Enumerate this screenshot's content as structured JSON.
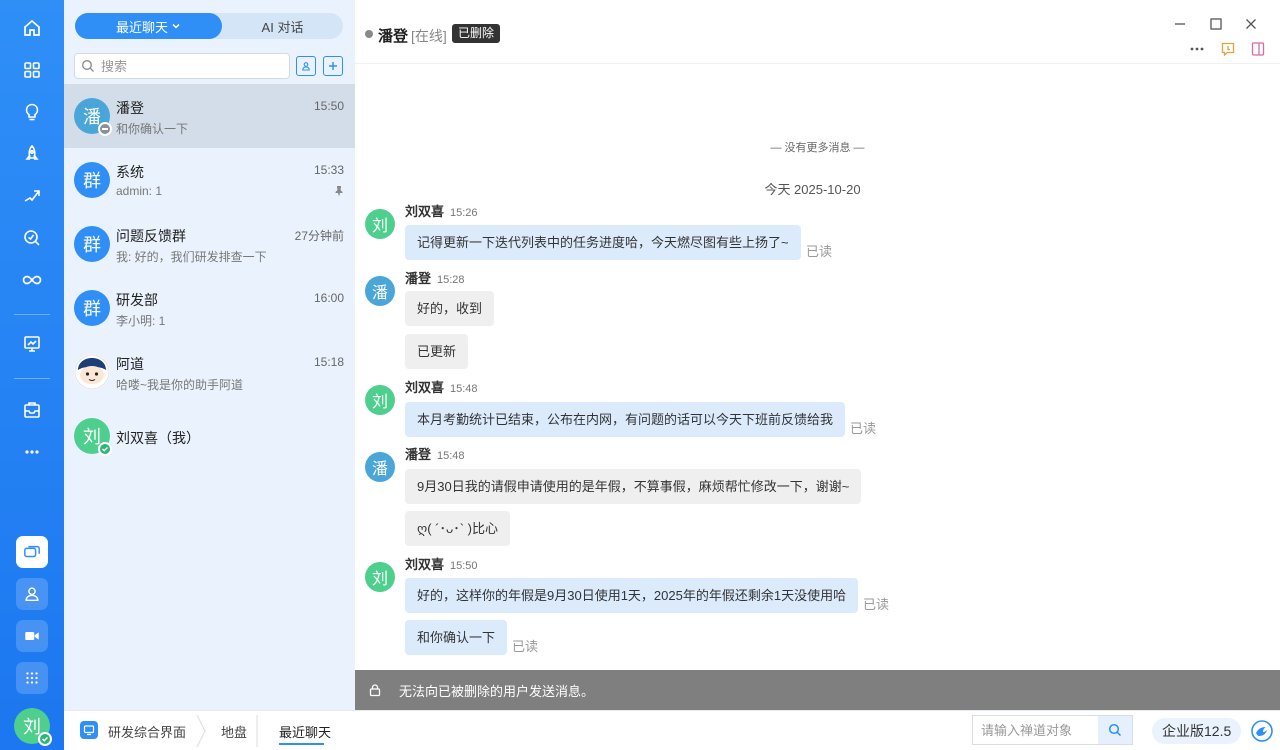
{
  "sidebar": {
    "tabs": {
      "recent": "最近聊天",
      "ai": "AI 对话"
    },
    "search_placeholder": "搜索",
    "conversations": [
      {
        "name": "潘登",
        "time": "15:50",
        "preview": "和你确认一下",
        "avatar": "潘",
        "avatar_color": "#4aa6d8",
        "status": "offline",
        "selected": true
      },
      {
        "name": "系统",
        "time": "15:33",
        "preview": "admin: 1",
        "avatar": "群",
        "avatar_color": "#2f8ff7",
        "pinned": true
      },
      {
        "name": "问题反馈群",
        "time": "27分钟前",
        "preview": "我: 好的，我们研发排查一下",
        "avatar": "群",
        "avatar_color": "#2f8ff7"
      },
      {
        "name": "研发部",
        "time": "16:00",
        "preview": "李小明: 1",
        "avatar": "群",
        "avatar_color": "#2f8ff7"
      },
      {
        "name": "阿道",
        "time": "15:18",
        "preview": "哈喽~我是你的助手阿道",
        "avatar": "",
        "avatar_color": "#ffffff"
      },
      {
        "name": "刘双喜（我）",
        "time": "",
        "preview": "",
        "avatar": "刘",
        "avatar_color": "#4fcf8e",
        "status": "online"
      }
    ]
  },
  "rail": {
    "me_avatar": "刘"
  },
  "chat": {
    "name": "潘登",
    "status": "[在线]",
    "tag": "已删除",
    "no_more": "— 没有更多消息 —",
    "date": "今天 2025-10-20",
    "messages": [
      {
        "sender": "刘双喜",
        "time": "15:26",
        "avatar": "刘",
        "avatar_color": "#4fcf8e",
        "mine": true,
        "bubbles": [
          {
            "text": "记得更新一下迭代列表中的任务进度哈，今天燃尽图有些上扬了~",
            "read": "已读"
          }
        ]
      },
      {
        "sender": "潘登",
        "time": "15:28",
        "avatar": "潘",
        "avatar_color": "#4aa6d8",
        "mine": false,
        "bubbles": [
          {
            "text": "好的，收到"
          },
          {
            "text": "已更新"
          }
        ]
      },
      {
        "sender": "刘双喜",
        "time": "15:48",
        "avatar": "刘",
        "avatar_color": "#4fcf8e",
        "mine": true,
        "bubbles": [
          {
            "text": "本月考勤统计已结束，公布在内网，有问题的话可以今天下班前反馈给我",
            "read": "已读"
          }
        ]
      },
      {
        "sender": "潘登",
        "time": "15:48",
        "avatar": "潘",
        "avatar_color": "#4aa6d8",
        "mine": false,
        "bubbles": [
          {
            "text": "9月30日我的请假申请使用的是年假，不算事假，麻烦帮忙修改一下，谢谢~"
          },
          {
            "text": "ღ( ´･ᴗ･` )比心"
          }
        ]
      },
      {
        "sender": "刘双喜",
        "time": "15:50",
        "avatar": "刘",
        "avatar_color": "#4fcf8e",
        "mine": true,
        "bubbles": [
          {
            "text": "好的，这样你的年假是9月30日使用1天，2025年的年假还剩余1天没使用哈",
            "read": "已读"
          },
          {
            "text": "和你确认一下",
            "read": "已读"
          }
        ]
      }
    ],
    "banner": "无法向已被删除的用户发送消息。"
  },
  "bottom": {
    "crumb1": "研发综合界面",
    "crumb2": "地盘",
    "crumb3": "最近聊天",
    "search_placeholder": "请输入禅道对象",
    "version": "企业版12.5"
  }
}
